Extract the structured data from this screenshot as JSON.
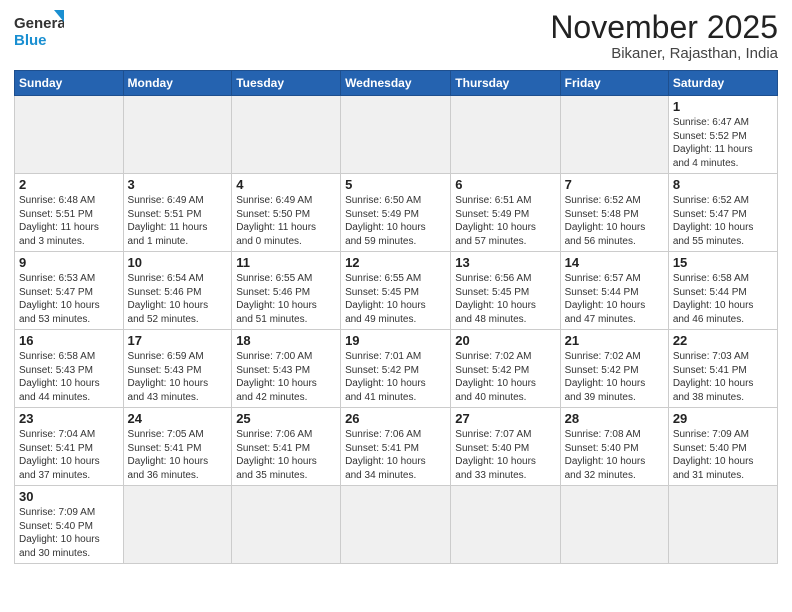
{
  "logo": {
    "line1": "General",
    "line2": "Blue"
  },
  "title": "November 2025",
  "subtitle": "Bikaner, Rajasthan, India",
  "weekdays": [
    "Sunday",
    "Monday",
    "Tuesday",
    "Wednesday",
    "Thursday",
    "Friday",
    "Saturday"
  ],
  "weeks": [
    [
      {
        "day": "",
        "info": ""
      },
      {
        "day": "",
        "info": ""
      },
      {
        "day": "",
        "info": ""
      },
      {
        "day": "",
        "info": ""
      },
      {
        "day": "",
        "info": ""
      },
      {
        "day": "",
        "info": ""
      },
      {
        "day": "1",
        "info": "Sunrise: 6:47 AM\nSunset: 5:52 PM\nDaylight: 11 hours\nand 4 minutes."
      }
    ],
    [
      {
        "day": "2",
        "info": "Sunrise: 6:48 AM\nSunset: 5:51 PM\nDaylight: 11 hours\nand 3 minutes."
      },
      {
        "day": "3",
        "info": "Sunrise: 6:49 AM\nSunset: 5:51 PM\nDaylight: 11 hours\nand 1 minute."
      },
      {
        "day": "4",
        "info": "Sunrise: 6:49 AM\nSunset: 5:50 PM\nDaylight: 11 hours\nand 0 minutes."
      },
      {
        "day": "5",
        "info": "Sunrise: 6:50 AM\nSunset: 5:49 PM\nDaylight: 10 hours\nand 59 minutes."
      },
      {
        "day": "6",
        "info": "Sunrise: 6:51 AM\nSunset: 5:49 PM\nDaylight: 10 hours\nand 57 minutes."
      },
      {
        "day": "7",
        "info": "Sunrise: 6:52 AM\nSunset: 5:48 PM\nDaylight: 10 hours\nand 56 minutes."
      },
      {
        "day": "8",
        "info": "Sunrise: 6:52 AM\nSunset: 5:47 PM\nDaylight: 10 hours\nand 55 minutes."
      }
    ],
    [
      {
        "day": "9",
        "info": "Sunrise: 6:53 AM\nSunset: 5:47 PM\nDaylight: 10 hours\nand 53 minutes."
      },
      {
        "day": "10",
        "info": "Sunrise: 6:54 AM\nSunset: 5:46 PM\nDaylight: 10 hours\nand 52 minutes."
      },
      {
        "day": "11",
        "info": "Sunrise: 6:55 AM\nSunset: 5:46 PM\nDaylight: 10 hours\nand 51 minutes."
      },
      {
        "day": "12",
        "info": "Sunrise: 6:55 AM\nSunset: 5:45 PM\nDaylight: 10 hours\nand 49 minutes."
      },
      {
        "day": "13",
        "info": "Sunrise: 6:56 AM\nSunset: 5:45 PM\nDaylight: 10 hours\nand 48 minutes."
      },
      {
        "day": "14",
        "info": "Sunrise: 6:57 AM\nSunset: 5:44 PM\nDaylight: 10 hours\nand 47 minutes."
      },
      {
        "day": "15",
        "info": "Sunrise: 6:58 AM\nSunset: 5:44 PM\nDaylight: 10 hours\nand 46 minutes."
      }
    ],
    [
      {
        "day": "16",
        "info": "Sunrise: 6:58 AM\nSunset: 5:43 PM\nDaylight: 10 hours\nand 44 minutes."
      },
      {
        "day": "17",
        "info": "Sunrise: 6:59 AM\nSunset: 5:43 PM\nDaylight: 10 hours\nand 43 minutes."
      },
      {
        "day": "18",
        "info": "Sunrise: 7:00 AM\nSunset: 5:43 PM\nDaylight: 10 hours\nand 42 minutes."
      },
      {
        "day": "19",
        "info": "Sunrise: 7:01 AM\nSunset: 5:42 PM\nDaylight: 10 hours\nand 41 minutes."
      },
      {
        "day": "20",
        "info": "Sunrise: 7:02 AM\nSunset: 5:42 PM\nDaylight: 10 hours\nand 40 minutes."
      },
      {
        "day": "21",
        "info": "Sunrise: 7:02 AM\nSunset: 5:42 PM\nDaylight: 10 hours\nand 39 minutes."
      },
      {
        "day": "22",
        "info": "Sunrise: 7:03 AM\nSunset: 5:41 PM\nDaylight: 10 hours\nand 38 minutes."
      }
    ],
    [
      {
        "day": "23",
        "info": "Sunrise: 7:04 AM\nSunset: 5:41 PM\nDaylight: 10 hours\nand 37 minutes."
      },
      {
        "day": "24",
        "info": "Sunrise: 7:05 AM\nSunset: 5:41 PM\nDaylight: 10 hours\nand 36 minutes."
      },
      {
        "day": "25",
        "info": "Sunrise: 7:06 AM\nSunset: 5:41 PM\nDaylight: 10 hours\nand 35 minutes."
      },
      {
        "day": "26",
        "info": "Sunrise: 7:06 AM\nSunset: 5:41 PM\nDaylight: 10 hours\nand 34 minutes."
      },
      {
        "day": "27",
        "info": "Sunrise: 7:07 AM\nSunset: 5:40 PM\nDaylight: 10 hours\nand 33 minutes."
      },
      {
        "day": "28",
        "info": "Sunrise: 7:08 AM\nSunset: 5:40 PM\nDaylight: 10 hours\nand 32 minutes."
      },
      {
        "day": "29",
        "info": "Sunrise: 7:09 AM\nSunset: 5:40 PM\nDaylight: 10 hours\nand 31 minutes."
      }
    ],
    [
      {
        "day": "30",
        "info": "Sunrise: 7:09 AM\nSunset: 5:40 PM\nDaylight: 10 hours\nand 30 minutes."
      },
      {
        "day": "",
        "info": ""
      },
      {
        "day": "",
        "info": ""
      },
      {
        "day": "",
        "info": ""
      },
      {
        "day": "",
        "info": ""
      },
      {
        "day": "",
        "info": ""
      },
      {
        "day": "",
        "info": ""
      }
    ]
  ]
}
